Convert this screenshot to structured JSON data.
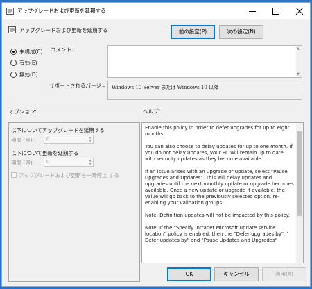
{
  "window": {
    "title": "アップグレードおよび更新を延期する"
  },
  "header": {
    "policy_name": "アップグレードおよび更新を延期する",
    "prev_button": "前の設定(P)",
    "next_button": "次の設定(N)"
  },
  "state": {
    "options": [
      {
        "label": "未構成(C)",
        "selected": true
      },
      {
        "label": "有効(E)",
        "selected": false
      },
      {
        "label": "無効(D)",
        "selected": false
      }
    ]
  },
  "comment": {
    "label": "コメント:",
    "value": ""
  },
  "support": {
    "label": "サポートされるバージョン:",
    "value": "Windows 10 Server または Windows 10 以降"
  },
  "options_section": {
    "label": "オプション:",
    "upgrade_defer_label": "以下についてアップグレードを延期する",
    "months_label": "期間 (月):",
    "months_value": "0",
    "updates_defer_label": "以下について更新を延期する",
    "weeks_label": "期間 (週):",
    "weeks_value": "0",
    "pause_label": "アップグレードおよび更新を一時停止 する",
    "pause_checked": false
  },
  "help_section": {
    "label": "ヘルプ:",
    "paragraphs": [
      "Enable this policy in order to defer upgrades for up to eight months.",
      "You can also choose to delay updates for up to one month. If you do not delay updates, your PC will remain up to date with security updates as they become available.",
      "If an issue arises with an upgrade or update, select \"Pause Upgrades and Updates\". This will delay updates and upgrades until the next monthly update or upgrade becomes available. Once a new update or upgrade it available, the value will go back to the previously selected option, re-enabling your validation groups.",
      "Note: Definition updates will not be impacted by this policy.",
      "Note: If the \"Specify intranet Microsoft update service location\" policy is enabled, then the \"Defer upgrades by\", \" Defer updates by\" and \"Pause Updates and Upgrades\""
    ]
  },
  "footer": {
    "ok": "OK",
    "cancel": "キャンセル",
    "apply": "適用(A)"
  }
}
